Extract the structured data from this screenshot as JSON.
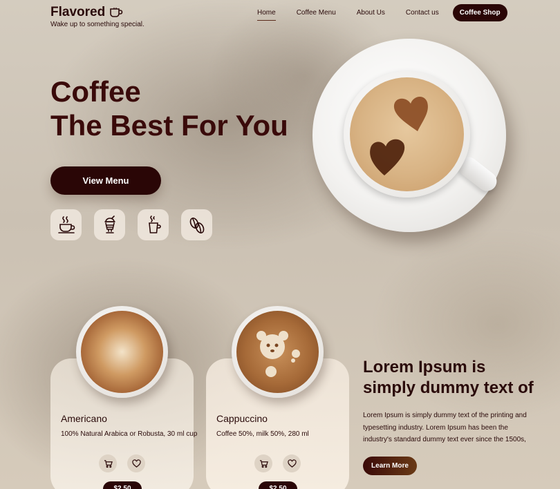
{
  "brand": {
    "name": "Flavored",
    "tagline": "Wake up to something special."
  },
  "nav": {
    "items": [
      "Home",
      "Coffee Menu",
      "About Us",
      "Contact us"
    ],
    "active": "Home",
    "cta": "Coffee Shop"
  },
  "hero": {
    "title_line1": "Coffee",
    "title_line2": "The Best For You",
    "button": "View Menu",
    "icons": [
      "hot-coffee-icon",
      "iced-drink-icon",
      "takeaway-cup-icon",
      "coffee-beans-icon"
    ]
  },
  "products": [
    {
      "name": "Americano",
      "description": "100% Natural Arabica or Robusta, 30 ml cup",
      "price": "$2.50"
    },
    {
      "name": "Cappuccino",
      "description": "Coffee 50%, milk 50%, 280 ml",
      "price": "$2.50"
    }
  ],
  "promo": {
    "title_line1": "Lorem Ipsum is",
    "title_line2": "simply dummy text of",
    "body": "Lorem Ipsum is simply dummy text of the printing and typesetting industry. Lorem Ipsum has been the industry's standard dummy text ever since the 1500s,",
    "button": "Learn More"
  },
  "colors": {
    "primary": "#2a0606",
    "text": "#2a0a0a",
    "background": "#cfc6b8"
  }
}
